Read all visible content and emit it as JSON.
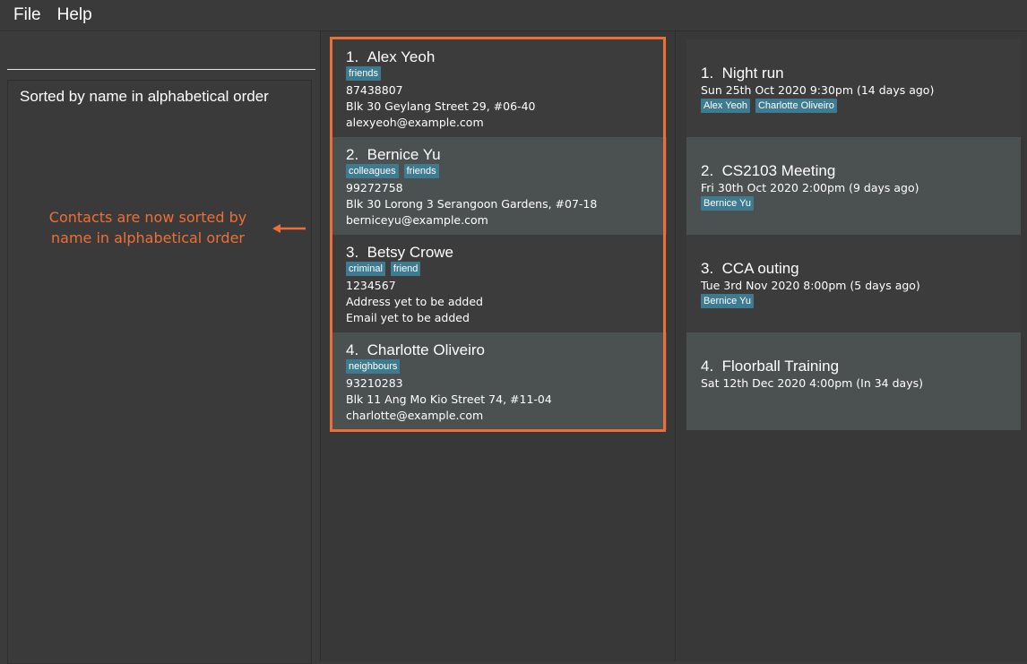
{
  "menubar": {
    "file_label": "File",
    "help_label": "Help"
  },
  "command": {
    "value": "",
    "placeholder": ""
  },
  "result": {
    "text": "Sorted by name in alphabetical order"
  },
  "annotation": {
    "line1": "Contacts are now sorted by",
    "line2": "name in alphabetical order",
    "color": "#ee6f35",
    "arrow_icon": "arrow-left-icon"
  },
  "persons": [
    {
      "index": "1.",
      "name": "Alex Yeoh",
      "tags": [
        "friends"
      ],
      "phone": "87438807",
      "address": "Blk 30 Geylang Street 29, #06-40",
      "email": "alexyeoh@example.com"
    },
    {
      "index": "2.",
      "name": "Bernice Yu",
      "tags": [
        "colleagues",
        "friends"
      ],
      "phone": "99272758",
      "address": "Blk 30 Lorong 3 Serangoon Gardens, #07-18",
      "email": "berniceyu@example.com"
    },
    {
      "index": "3.",
      "name": "Betsy Crowe",
      "tags": [
        "criminal",
        "friend"
      ],
      "phone": "1234567",
      "address": "Address yet to be added",
      "email": "Email yet to be added"
    },
    {
      "index": "4.",
      "name": "Charlotte Oliveiro",
      "tags": [
        "neighbours"
      ],
      "phone": "93210283",
      "address": "Blk 11 Ang Mo Kio Street 74, #11-04",
      "email": "charlotte@example.com"
    }
  ],
  "events": [
    {
      "index": "1.",
      "name": "Night run",
      "datetime": "Sun 25th Oct 2020 9:30pm (14 days ago)",
      "tags": [
        "Alex Yeoh",
        "Charlotte Oliveiro"
      ]
    },
    {
      "index": "2.",
      "name": "CS2103 Meeting",
      "datetime": "Fri 30th Oct 2020 2:00pm (9 days ago)",
      "tags": [
        "Bernice Yu"
      ]
    },
    {
      "index": "3.",
      "name": "CCA outing",
      "datetime": "Tue 3rd Nov 2020 8:00pm (5 days ago)",
      "tags": [
        "Bernice Yu"
      ]
    },
    {
      "index": "4.",
      "name": "Floorball Training",
      "datetime": "Sat 12th Dec 2020 4:00pm (In 34 days)",
      "tags": []
    }
  ],
  "colors": {
    "background": "#3b3b3b",
    "card_light": "#4b5051",
    "card_dark": "#3c3c3c",
    "tag": "#3e7b91",
    "highlight": "#ee6f35"
  }
}
